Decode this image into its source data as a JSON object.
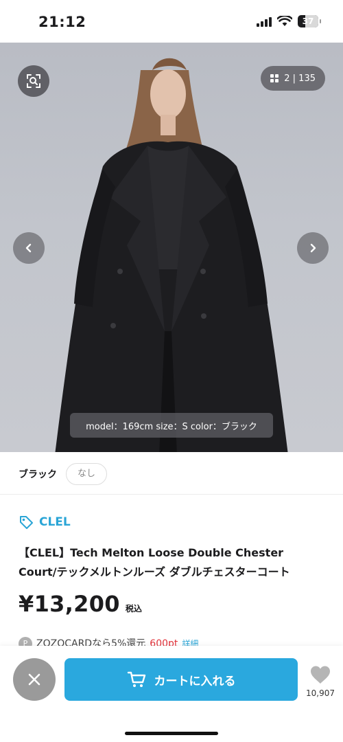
{
  "status_bar": {
    "time": "21:12",
    "battery": "37",
    "icons": [
      "signal-icon",
      "wifi-icon",
      "battery-icon"
    ]
  },
  "photo": {
    "counter": "2 | 135",
    "caption": "model：169cm size：S color：ブラック",
    "colors": {
      "background": "#c2c5cc",
      "coat": "#1d1d20"
    }
  },
  "color_select": {
    "label": "ブラック",
    "option": "なし"
  },
  "product": {
    "brand": "CLEL",
    "title_line1": "【CLEL】Tech Melton Loose Double Chester",
    "title_line2": "Court/テックメルトンルーズ ダブルチェスターコート",
    "price": "¥13,200",
    "tax_label": "税込",
    "card_badge": "P",
    "card_note": "ZOZOCARDなら5%還元",
    "card_points": "600pt",
    "card_link": "詳細"
  },
  "actions": {
    "cart_label": "カートに入れる",
    "favorite_count": "10,907"
  },
  "theme": {
    "accent": "#2aa8de",
    "brand_color": "#2aa5d6",
    "point_red": "#e2323a"
  }
}
